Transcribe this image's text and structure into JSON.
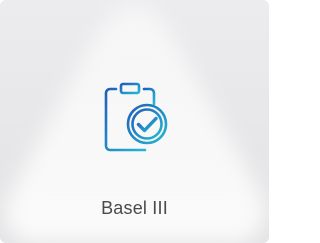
{
  "tile": {
    "label": "Basel III",
    "icon": "clipboard-check-icon"
  },
  "colors": {
    "icon_gradient_start": "#1f5fb8",
    "icon_gradient_end": "#25b7d3",
    "label_text": "#4a4a4a",
    "tile_background": "#e9e9eb"
  }
}
